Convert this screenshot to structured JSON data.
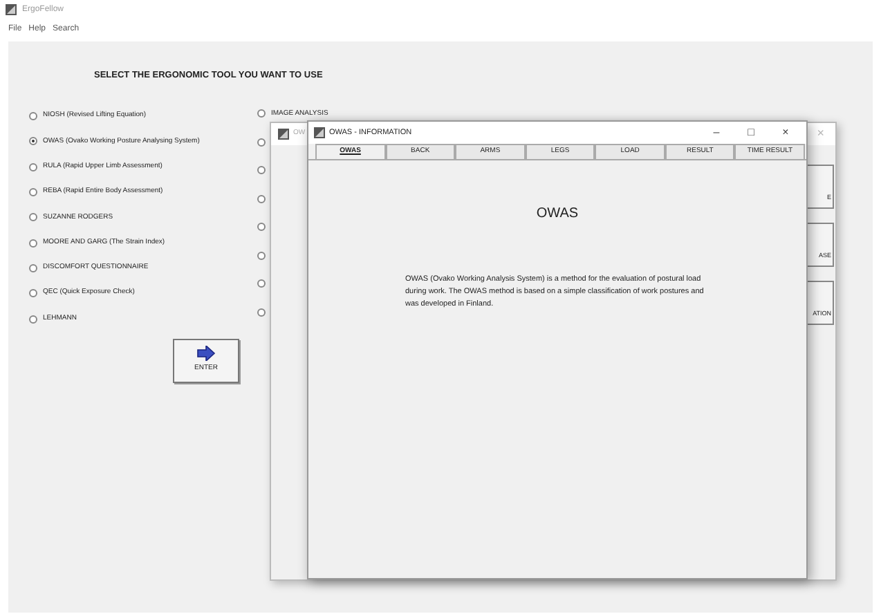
{
  "app": {
    "title": "ErgoFellow",
    "menu": [
      "File",
      "Help",
      "Search"
    ]
  },
  "heading": "SELECT THE ERGONOMIC TOOL YOU WANT TO USE",
  "tools": [
    {
      "label": "NIOSH  (Revised Lifting Equation)",
      "selected": false
    },
    {
      "label": "OWAS  (Ovako Working Posture Analysing System)",
      "selected": true
    },
    {
      "label": "RULA  (Rapid Upper Limb Assessment)",
      "selected": false
    },
    {
      "label": "REBA  (Rapid Entire Body Assessment)",
      "selected": false
    },
    {
      "label": "SUZANNE RODGERS",
      "selected": false
    },
    {
      "label": "MOORE AND GARG (The Strain Index)",
      "selected": false
    },
    {
      "label": "DISCOMFORT QUESTIONNAIRE",
      "selected": false
    },
    {
      "label": "QEC  (Quick Exposure Check)",
      "selected": false
    },
    {
      "label": "LEHMANN",
      "selected": false
    }
  ],
  "enter_button": "ENTER",
  "tools_column_2": [
    {
      "label": "IMAGE ANALYSIS",
      "selected": false
    },
    {
      "selected": false
    },
    {
      "selected": false
    },
    {
      "selected": false
    },
    {
      "selected": false
    },
    {
      "selected": false
    },
    {
      "selected": false
    },
    {
      "selected": false
    }
  ],
  "back_window": {
    "title": "OW",
    "close": "×",
    "buttons": [
      "E",
      "ASE",
      "ATION"
    ]
  },
  "info_window": {
    "title": "OWAS - INFORMATION",
    "controls": [
      "–",
      "□",
      "×"
    ],
    "tabs": [
      {
        "label": "OWAS",
        "selected": true
      },
      {
        "label": "BACK",
        "selected": false
      },
      {
        "label": "ARMS",
        "selected": false
      },
      {
        "label": "LEGS",
        "selected": false
      },
      {
        "label": "LOAD",
        "selected": false
      },
      {
        "label": "RESULT",
        "selected": false
      },
      {
        "label": "TIME RESULT",
        "selected": false
      }
    ],
    "heading": "OWAS",
    "text": "OWAS (Ovako Working Analysis System) is a method for the evaluation of postural load during work. The OWAS method is based on a simple classification of work postures and was developed in Finland."
  }
}
